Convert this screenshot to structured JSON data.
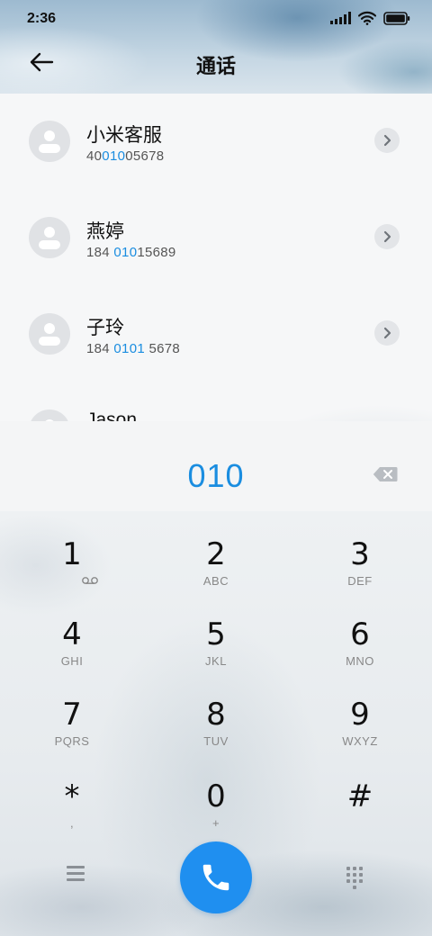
{
  "status_bar": {
    "time": "2:36",
    "icons": [
      "signal-icon",
      "wifi-icon",
      "battery-icon"
    ]
  },
  "header": {
    "title": "通话",
    "back_icon": "back-arrow-icon"
  },
  "contacts": [
    {
      "name": "小米客服",
      "number_parts": [
        {
          "text": "40",
          "highlight": false
        },
        {
          "text": "010",
          "highlight": true
        },
        {
          "text": "05678",
          "highlight": false
        }
      ]
    },
    {
      "name": "燕婷",
      "number_parts": [
        {
          "text": "184 ",
          "highlight": false
        },
        {
          "text": "010",
          "highlight": true
        },
        {
          "text": "15689",
          "highlight": false
        }
      ]
    },
    {
      "name": "子玲",
      "number_parts": [
        {
          "text": "184 ",
          "highlight": false
        },
        {
          "text": "0101",
          "highlight": true
        },
        {
          "text": " 5678",
          "highlight": false
        }
      ]
    },
    {
      "name": "Jason",
      "number_parts": []
    }
  ],
  "dialer": {
    "entered_number": "010",
    "delete_icon": "backspace-icon",
    "keys": [
      {
        "digit": "1",
        "letters": "",
        "icon": "voicemail-icon"
      },
      {
        "digit": "2",
        "letters": "ABC"
      },
      {
        "digit": "3",
        "letters": "DEF"
      },
      {
        "digit": "4",
        "letters": "GHI"
      },
      {
        "digit": "5",
        "letters": "JKL"
      },
      {
        "digit": "6",
        "letters": "MNO"
      },
      {
        "digit": "7",
        "letters": "PQRS"
      },
      {
        "digit": "8",
        "letters": "TUV"
      },
      {
        "digit": "9",
        "letters": "WXYZ"
      },
      {
        "digit": "*",
        "letters": ","
      },
      {
        "digit": "0",
        "letters": "+"
      },
      {
        "digit": "#",
        "letters": ""
      }
    ],
    "bottom_bar": {
      "menu_icon": "menu-icon",
      "call_icon": "phone-icon",
      "dialpad_icon": "dialpad-icon"
    },
    "accent_color": "#1a8de0",
    "call_button_color": "#1f8ff0"
  }
}
